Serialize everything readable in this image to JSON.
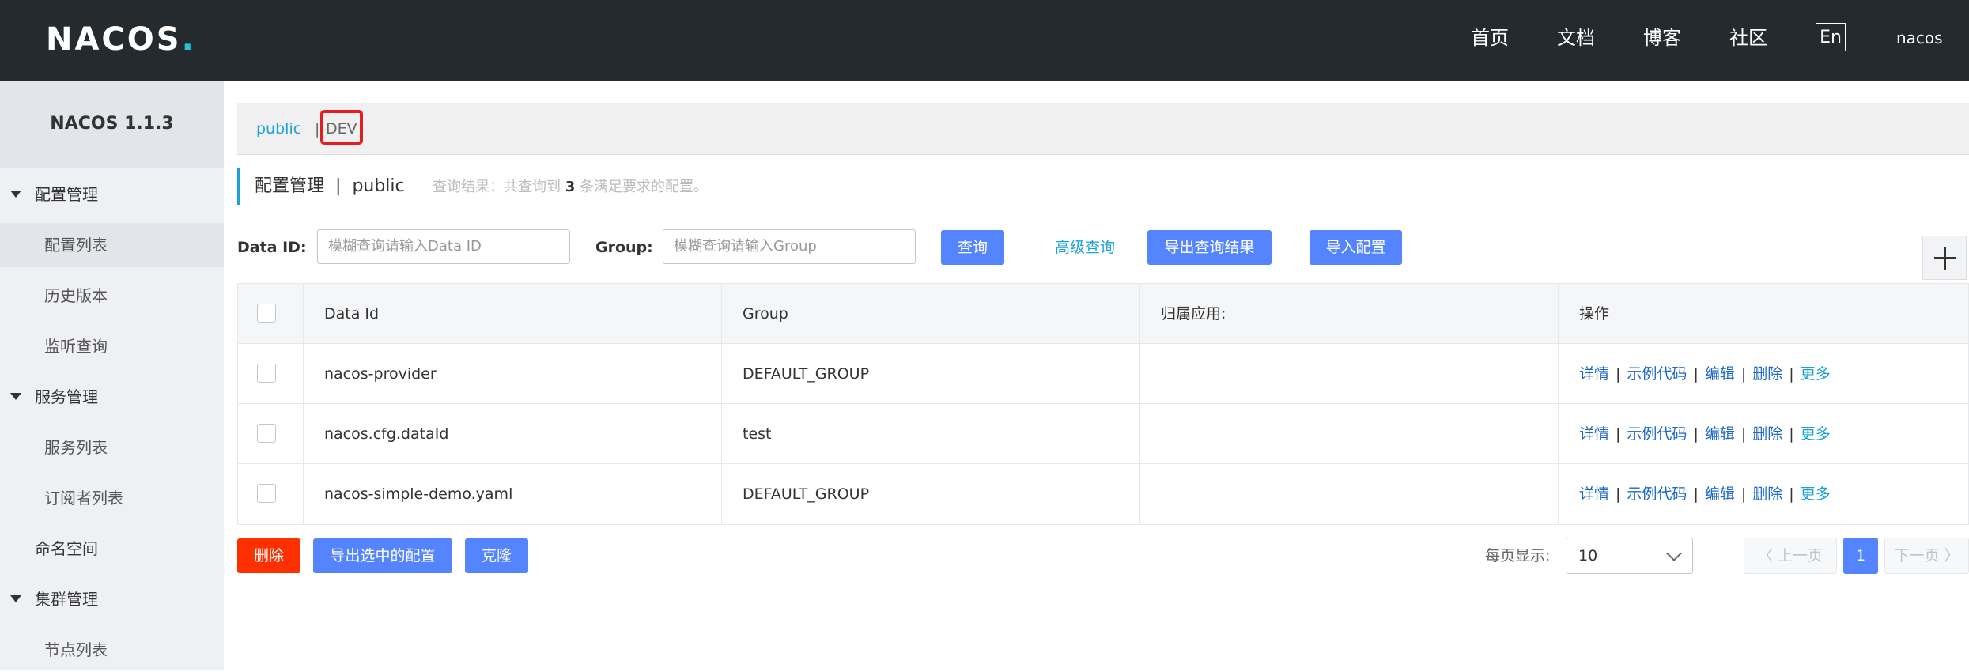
{
  "header": {
    "logo_main": "NACOS",
    "logo_dot": ".",
    "nav": [
      "首页",
      "文档",
      "博客",
      "社区"
    ],
    "lang": "En",
    "user": "nacos"
  },
  "sidebar": {
    "version": "NACOS 1.1.3",
    "groups": [
      {
        "label": "配置管理",
        "items": [
          "配置列表",
          "历史版本",
          "监听查询"
        ]
      },
      {
        "label": "服务管理",
        "items": [
          "服务列表",
          "订阅者列表"
        ]
      },
      {
        "label": "命名空间",
        "items": []
      },
      {
        "label": "集群管理",
        "items": [
          "节点列表"
        ]
      }
    ]
  },
  "namespace": {
    "tabs": [
      "public",
      "DEV"
    ],
    "separator": "|"
  },
  "page": {
    "title": "配置管理",
    "title_sep": "|",
    "title_ns": "public",
    "result_prefix": "查询结果：共查询到",
    "result_count": "3",
    "result_suffix": "条满足要求的配置。"
  },
  "filters": {
    "data_id_label": "Data ID:",
    "data_id_placeholder": "模糊查询请输入Data ID",
    "group_label": "Group:",
    "group_placeholder": "模糊查询请输入Group",
    "query_btn": "查询",
    "advanced_btn": "高级查询",
    "export_btn": "导出查询结果",
    "import_btn": "导入配置"
  },
  "table": {
    "columns": [
      "Data Id",
      "Group",
      "归属应用:",
      "操作"
    ],
    "rows": [
      {
        "data_id": "nacos-provider",
        "group": "DEFAULT_GROUP",
        "app": ""
      },
      {
        "data_id": "nacos.cfg.dataId",
        "group": "test",
        "app": ""
      },
      {
        "data_id": "nacos-simple-demo.yaml",
        "group": "DEFAULT_GROUP",
        "app": ""
      }
    ],
    "ops": {
      "detail": "详情",
      "sample": "示例代码",
      "edit": "编辑",
      "delete": "删除",
      "more": "更多",
      "sep": "|"
    }
  },
  "footer": {
    "delete_btn": "删除",
    "export_selected_btn": "导出选中的配置",
    "clone_btn": "克隆",
    "page_size_label": "每页显示:",
    "page_size": "10",
    "prev": "〈 上一页",
    "current_page": "1",
    "next": "下一页 〉"
  },
  "colors": {
    "header_bg": "#252a2f",
    "accent": "#1aa1d8",
    "primary_btn": "#5584ff",
    "danger_btn": "#ff3000",
    "highlight": "#e02020"
  }
}
